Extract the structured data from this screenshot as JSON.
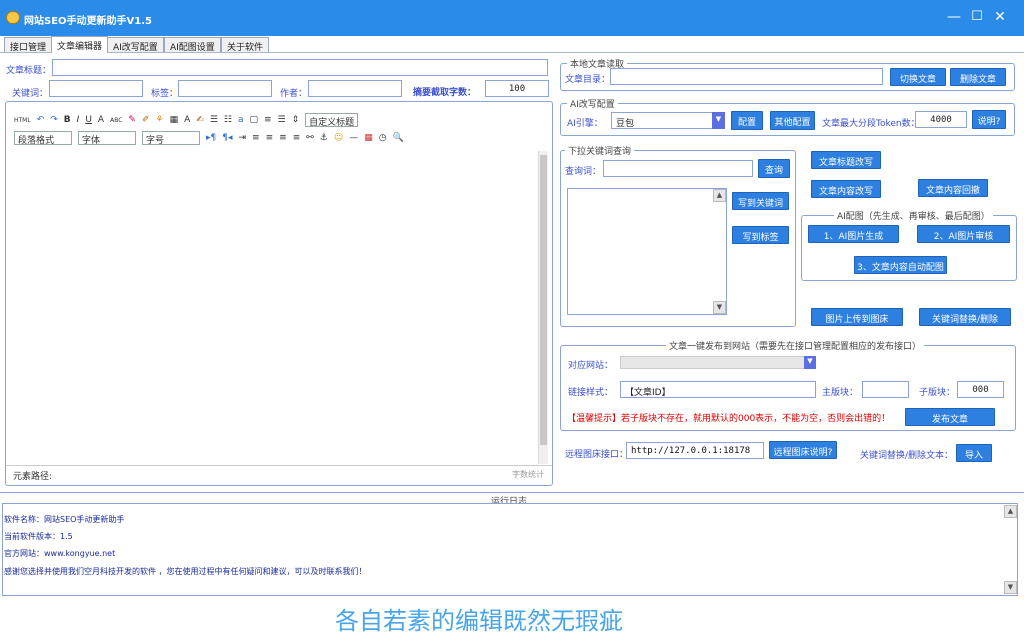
{
  "window": {
    "title": "网站SEO手动更新助手V1.5"
  },
  "tabs": [
    "接口管理",
    "文章编辑器",
    "AI改写配置",
    "AI配图设置",
    "关于软件"
  ],
  "article": {
    "title_label": "文章标题：",
    "keyword_label": "关键词：",
    "tag_label": "标签：",
    "author_label": "作者：",
    "summary_label": "摘要截取字数：",
    "summary_value": "100"
  },
  "editor": {
    "toolbar_row1": [
      "HTML",
      "↶",
      "↷",
      "B",
      "I",
      "U",
      "A",
      "ABC",
      "✎",
      "✐",
      "⚘",
      "▦",
      "A",
      "✍",
      "☰",
      "☷",
      "a",
      "▢",
      "≡",
      "☰",
      "⇕"
    ],
    "custom_title": "自定义标题",
    "para_format": "段落格式",
    "font": "字体",
    "font_size": "字号",
    "element_path": "元素路径:",
    "word_count": "字数统计"
  },
  "local": {
    "legend": "本地文章读取",
    "dir_label": "文章目录：",
    "switch_btn": "切换文章",
    "delete_btn": "删除文章"
  },
  "ai": {
    "legend": "AI改写配置",
    "engine_label": "AI引擎：",
    "engine_value": "豆包",
    "config_btn": "配置",
    "other_btn": "其他配置",
    "token_label": "文章最大分段Token数：",
    "token_value": "4000",
    "help_btn": "说明?"
  },
  "dropdown": {
    "legend": "下拉关键词查询",
    "query_label": "查询词：",
    "query_btn": "查询",
    "to_keyword_btn": "写到关键词",
    "to_tag_btn": "写到标签"
  },
  "rewrite": {
    "title_btn": "文章标题改写",
    "content_btn": "文章内容改写",
    "reply_btn": "文章内容回撤"
  },
  "aiimg": {
    "legend": "AI配图（先生成、再审核、最后配图）",
    "gen_btn": "1、AI图片生成",
    "review_btn": "2、AI图片审核",
    "auto_btn": "3、文章内容自动配图"
  },
  "bed": {
    "upload_btn": "图片上传到图床",
    "replace_btn": "关键词替换/删除"
  },
  "publish": {
    "legend": "文章一键发布到网站（需要先在接口管理配置相应的发布接口）",
    "site_label": "对应网站：",
    "link_label": "链接样式：",
    "link_value": "【文章ID】",
    "main_label": "主版块：",
    "sub_label": "子版块：",
    "sub_value": "000",
    "warn": "【温馨提示】若子版块不存在，就用默认的000表示，不能为空，否则会出错的！",
    "publish_btn": "发布文章"
  },
  "remote": {
    "label": "远程图床接口：",
    "value": "http://127.0.0.1:18178",
    "help_btn": "远程图床说明?",
    "kw_label": "关键词替换/删除文本：",
    "import_btn": "导入"
  },
  "log": {
    "legend": "运行日志",
    "lines": [
      "软件名称：网站SEO手动更新助手",
      "当前软件版本：1.5",
      "官方网站：www.kongyue.net",
      "感谢您选择并使用我们空月科技开发的软件 ，您在使用过程中有任何疑问和建议，可以及时联系我们！"
    ]
  },
  "footer": {
    "banner": "各自若素的编辑既然无瑕疵"
  },
  "colors": {
    "titlebar": "#2b8be8",
    "button": "#2d7fe0",
    "label": "#3a4fd0",
    "warn": "#e00000"
  }
}
